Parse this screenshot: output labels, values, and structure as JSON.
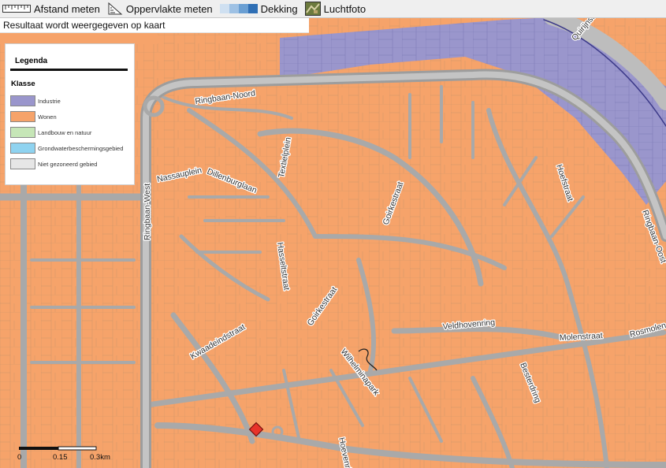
{
  "toolbar": {
    "items": [
      {
        "label": "Afstand meten",
        "icon": "ruler-icon"
      },
      {
        "label": "Oppervlakte meten",
        "icon": "area-ruler-icon"
      },
      {
        "label": "Dekking",
        "icon": "opacity-slider-icon"
      },
      {
        "label": "Luchtfoto",
        "icon": "aerial-photo-icon"
      }
    ]
  },
  "status_text": "Resultaat wordt weergegeven op kaart",
  "legend": {
    "title": "Legenda",
    "class_heading": "Klasse",
    "items": [
      {
        "label": "Industrie",
        "color": "#9a96cc"
      },
      {
        "label": "Wonen",
        "color": "#f6a36a"
      },
      {
        "label": "Landbouw en natuur",
        "color": "#c6e6b7"
      },
      {
        "label": "Grondwaterbeschermingsgebied",
        "color": "#8fd3f0"
      },
      {
        "label": "Niet gezoneerd gebied",
        "color": "#e6e6e6"
      }
    ]
  },
  "map": {
    "colors": {
      "residential": "#f6a36a",
      "industry": "#9a96cc",
      "roads": "#a9a9a9",
      "marker": "#e8332a"
    },
    "street_labels": [
      "Ringbaan-Noord",
      "Ringbaan-West",
      "Nassauplein",
      "Dillenburglaan",
      "Textielplein",
      "Goirkestraat",
      "Hoefstraat",
      "Ringbaan-Oost",
      "Hasseltstraat",
      "Goirkestraat",
      "Kwaadeindstraat",
      "Veldhovenring",
      "Molenstraat",
      "Rosmolen",
      "Wilhelminapark",
      "Besterdring",
      "Hoevenring",
      "Quirijnstok"
    ]
  },
  "scale": {
    "labels": [
      "0",
      "0.15",
      "0.3km"
    ]
  }
}
